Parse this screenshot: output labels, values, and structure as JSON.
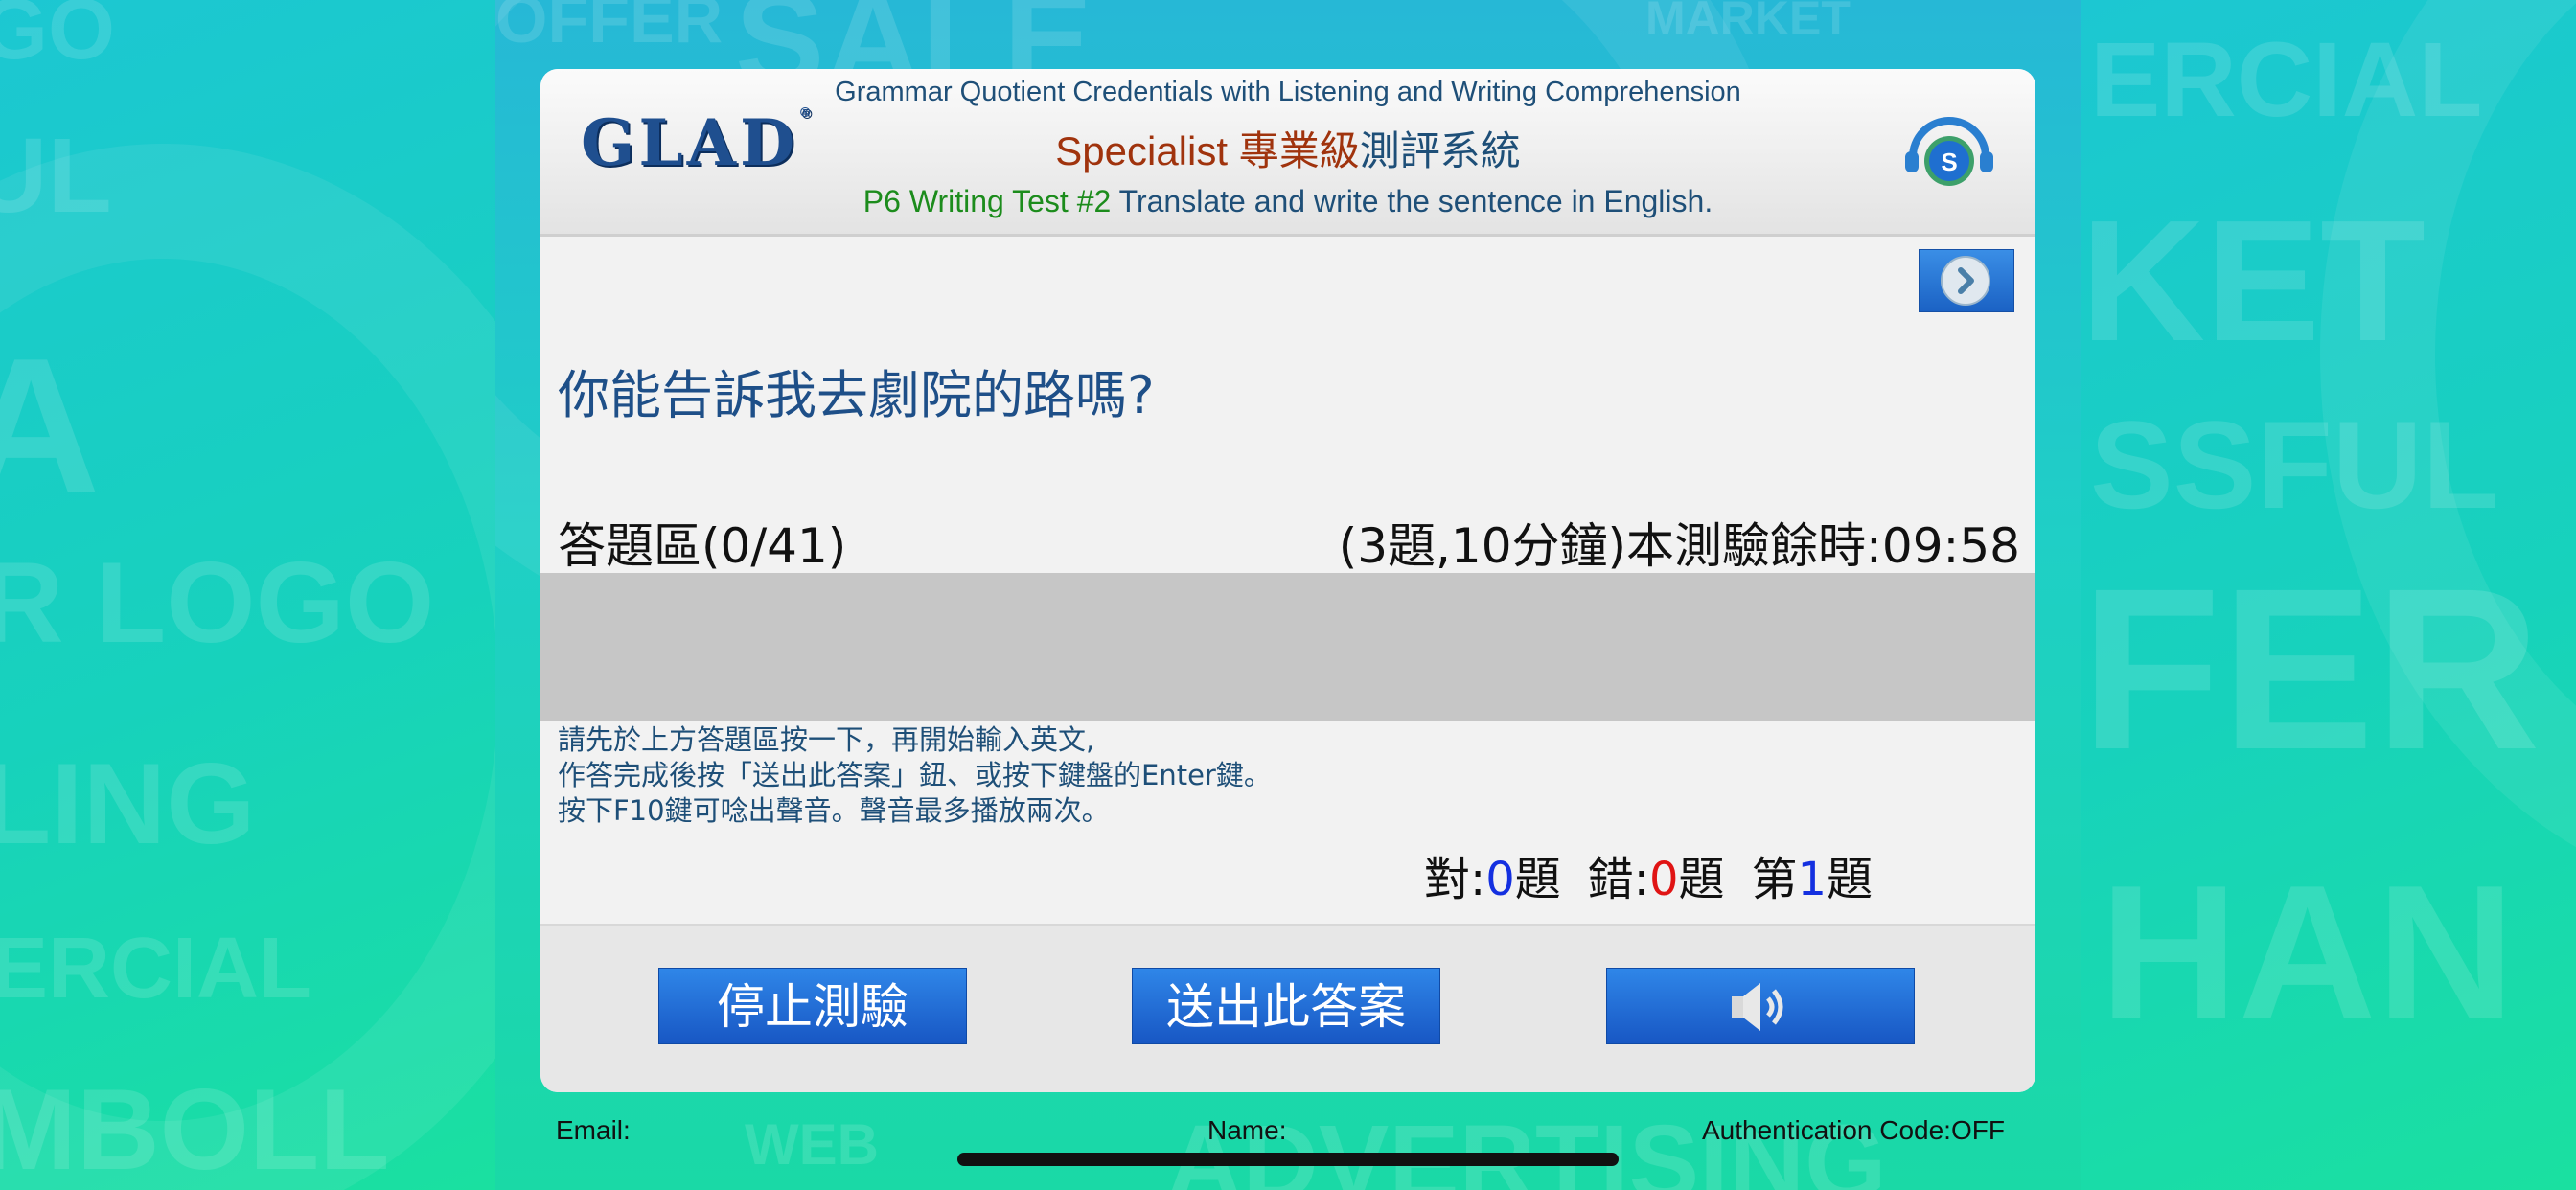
{
  "colors": {
    "background": "#1bd3b0",
    "panel": "#f2f2f2",
    "answer_area": "#c6c6c6",
    "button_blue": "#1b62c4",
    "title_blue": "#1e4f78",
    "specialist_red": "#a0330d",
    "test_green": "#1c8c1c"
  },
  "header": {
    "logo": "GLAD",
    "line1": "Grammar Quotient Credentials with Listening and Writing Comprehension",
    "line2_specialist": "Specialist",
    "line2_pro": "專業級",
    "line2_system": "測評系統",
    "line3_test": "P6 Writing Test #2",
    "line3_instruction": "Translate and write the sentence in English.",
    "support_icon": "headset-support-icon"
  },
  "next_button": {
    "icon": "chevron-right-icon"
  },
  "question": "你能告訴我去劇院的路嗎?",
  "answer": {
    "label": "答題區(0/41)",
    "timer": "(3題,10分鐘)本測驗餘時:09:58",
    "value": ""
  },
  "instructions": [
    "請先於上方答題區按一下，再開始輸入英文,",
    "作答完成後按「送出此答案」鈕、或按下鍵盤的Enter鍵。",
    "按下F10鍵可唸出聲音。聲音最多播放兩次。"
  ],
  "score": {
    "correct_prefix": "對:",
    "correct_value": "0",
    "correct_suffix": "題",
    "wrong_prefix": "錯:",
    "wrong_value": "0",
    "wrong_suffix": "題",
    "index_prefix": "第",
    "index_value": "1",
    "index_suffix": "題"
  },
  "buttons": {
    "stop": "停止測驗",
    "submit": "送出此答案",
    "sound_icon": "speaker-icon"
  },
  "footer": {
    "email": "Email:",
    "name": "Name:",
    "auth": "Authentication Code:OFF"
  }
}
